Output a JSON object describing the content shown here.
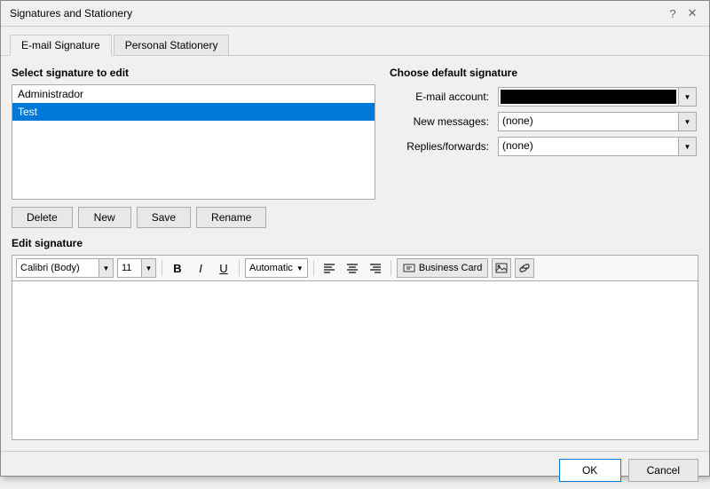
{
  "dialog": {
    "title": "Signatures and Stationery",
    "help_icon": "?",
    "close_icon": "✕"
  },
  "tabs": [
    {
      "id": "email-signature",
      "label": "E-mail Signature",
      "active": true
    },
    {
      "id": "personal-stationery",
      "label": "Personal Stationery",
      "active": false
    }
  ],
  "left_panel": {
    "section_label": "Select signature to edit",
    "signatures": [
      {
        "name": "Administrador",
        "selected": false
      },
      {
        "name": "Test",
        "selected": true
      }
    ],
    "buttons": {
      "delete": "Delete",
      "new": "New",
      "save": "Save",
      "rename": "Rename"
    }
  },
  "right_panel": {
    "section_label": "Choose default signature",
    "email_account_label": "E-mail account:",
    "email_account_value": "",
    "new_messages_label": "New messages:",
    "new_messages_value": "(none)",
    "replies_forwards_label": "Replies/forwards:",
    "replies_forwards_value": "(none)"
  },
  "edit_signature": {
    "section_label": "Edit signature",
    "toolbar": {
      "font_name": "Calibri (Body)",
      "font_size": "11",
      "bold": "B",
      "italic": "I",
      "underline": "U",
      "color_label": "Automatic",
      "align_left": "≡",
      "align_center": "≡",
      "align_right": "≡",
      "business_card_label": "Business Card",
      "image_btn": "🖼",
      "link_btn": "🌐"
    },
    "content": ""
  },
  "footer": {
    "ok_label": "OK",
    "cancel_label": "Cancel"
  }
}
